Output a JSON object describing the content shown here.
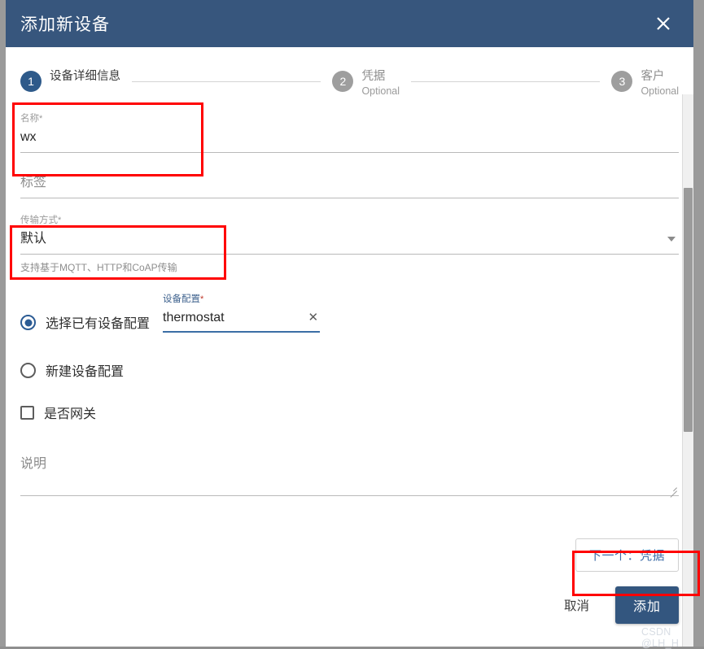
{
  "dialog": {
    "title": "添加新设备",
    "close_icon": "close-icon"
  },
  "stepper": {
    "steps": [
      {
        "number": "1",
        "label": "设备详细信息",
        "sub": "",
        "state": "active"
      },
      {
        "number": "2",
        "label": "凭据",
        "sub": "Optional",
        "state": "inactive"
      },
      {
        "number": "3",
        "label": "客户",
        "sub": "Optional",
        "state": "inactive"
      }
    ]
  },
  "form": {
    "name": {
      "label": "名称",
      "required_mark": "*",
      "value": "wx"
    },
    "label_field": {
      "placeholder": "标签",
      "value": ""
    },
    "transport": {
      "label": "传输方式",
      "required_mark": "*",
      "value": "默认",
      "hint": "支持基于MQTT、HTTP和CoAP传输",
      "caret_icon": "chevron-down-icon"
    },
    "profile_choice": {
      "existing": {
        "label": "选择已有设备配置",
        "selected": true
      },
      "new": {
        "label": "新建设备配置",
        "selected": false
      }
    },
    "device_profile": {
      "label": "设备配置",
      "required_mark": "*",
      "value": "thermostat",
      "clear_icon": "✕"
    },
    "gateway": {
      "label": "是否网关",
      "checked": false
    },
    "description": {
      "placeholder": "说明",
      "value": ""
    }
  },
  "actions": {
    "next": "下一个：凭据",
    "cancel": "取消",
    "submit": "添加"
  },
  "watermark": "CSDN @LH_H",
  "colors": {
    "titlebar": "#37567d",
    "step_active": "#2e5a8a",
    "step_inactive": "#9e9e9e",
    "accent": "#3b6ea5",
    "submit": "#33567f",
    "annotation": "#ff0000",
    "required": "#c0392b"
  }
}
